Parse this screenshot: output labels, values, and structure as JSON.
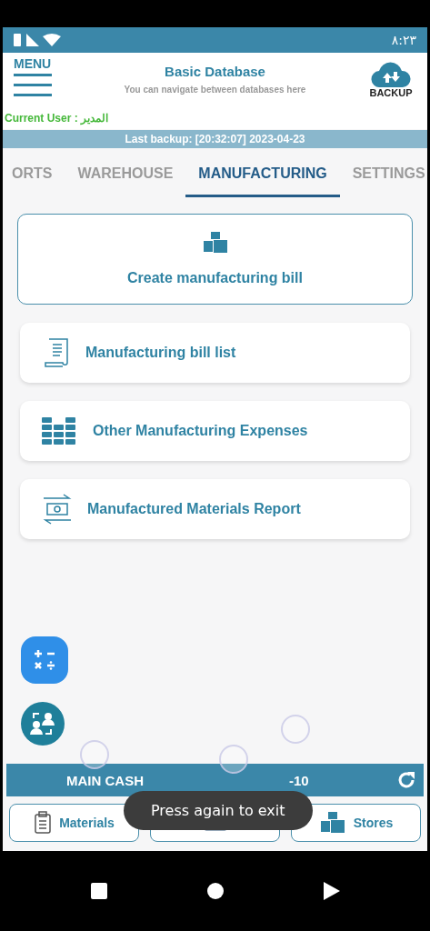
{
  "status_bar": {
    "time": "٨:٢٣"
  },
  "header": {
    "menu_label": "MENU",
    "title": "Basic Database",
    "subtitle": "You can navigate between databases here",
    "backup_label": "BACKUP",
    "current_user": "Current User : المدير"
  },
  "last_backup": "Last backup: [20:32:07] 2023-04-23",
  "tabs": [
    {
      "label": "ORTS",
      "selected": false
    },
    {
      "label": "WAREHOUSE",
      "selected": false
    },
    {
      "label": "MANUFACTURING",
      "selected": true
    },
    {
      "label": "SETTINGS",
      "selected": false
    }
  ],
  "actions": [
    {
      "kind": "primary",
      "label": "Create manufacturing bill"
    },
    {
      "kind": "row",
      "label": "Manufacturing bill list"
    },
    {
      "kind": "row",
      "label": "Other Manufacturing Expenses"
    },
    {
      "kind": "row",
      "label": "Manufactured Materials Report"
    }
  ],
  "cash_bar": {
    "label": "MAIN CASH",
    "value": "-10"
  },
  "bottom_buttons": [
    {
      "kind": "clipboard",
      "label": "Materials"
    },
    {
      "kind": "ledger"
    },
    {
      "kind": "boxes",
      "label": "Stores"
    }
  ],
  "toast": "Press again to exit"
}
